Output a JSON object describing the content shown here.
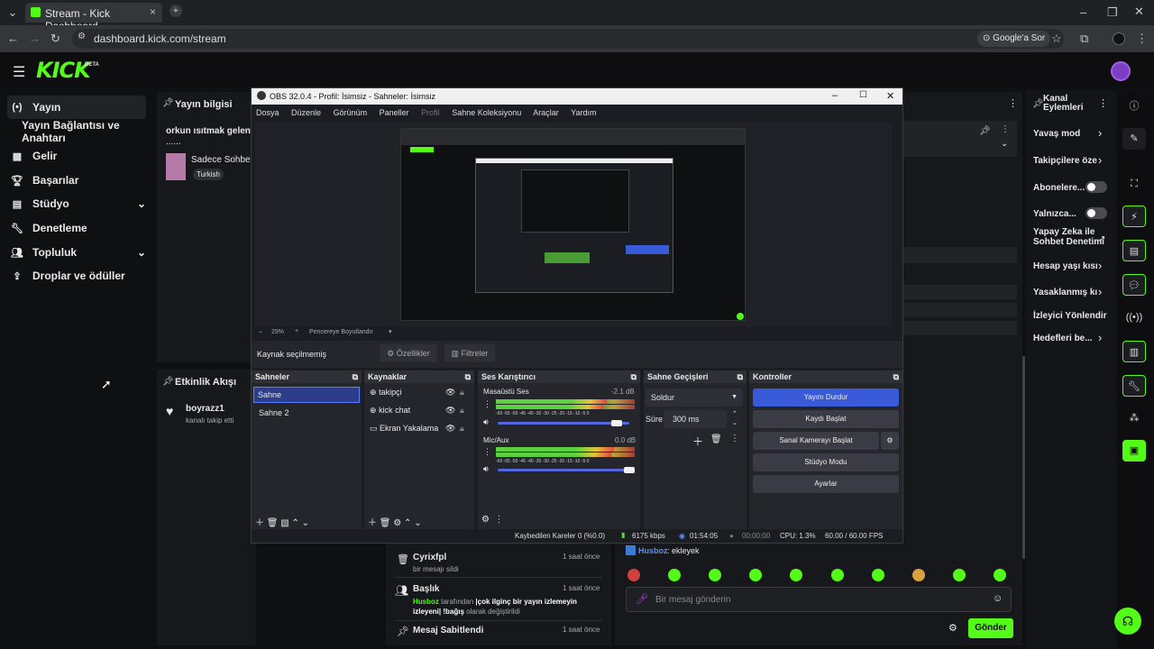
{
  "browser": {
    "tab_title": "Stream - Kick Dashboard",
    "url": "dashboard.kick.com/stream",
    "google_button": "Google'a Sor"
  },
  "kick": {
    "logo": "KICK",
    "beta": "BETA"
  },
  "nav": {
    "items": [
      {
        "label": "Yayın"
      },
      {
        "label": "Yayın Bağlantısı ve Anahtarı"
      },
      {
        "label": "Gelir"
      },
      {
        "label": "Başarılar"
      },
      {
        "label": "Stüdyo"
      },
      {
        "label": "Denetleme"
      },
      {
        "label": "Topluluk"
      },
      {
        "label": "Droplar ve ödüller"
      }
    ]
  },
  "stream_info": {
    "title": "Yayın bilgisi",
    "stream_title": "orkun ısıtmak gelene",
    "dots": "......",
    "category": "Sadece Sohbet",
    "tag": "Turkish"
  },
  "activity": {
    "title": "Etkinlik Akışı",
    "user": "boyrazz1",
    "text": "kanalı takip etti"
  },
  "mod_log": [
    {
      "title": "Cyrixfpl",
      "time": "1 saat önce",
      "text": "bir mesajı sildi"
    },
    {
      "title": "Başlık",
      "time": "1 saat önce",
      "user": "Husboz",
      "text1": "tarafından",
      "text2": "|çok ilginç bir yayın izlemeyin izleyeni| !bağış",
      "text3": "olarak değiştirildi"
    },
    {
      "title": "Mesaj Sabitlendi",
      "time": "1 saat önce"
    }
  ],
  "chat": {
    "last_user": "Husboz",
    "last_message": ": ekleyek",
    "placeholder": "Bir mesaj gönderin",
    "send": "Gönder"
  },
  "channel_actions": {
    "title": "Kanal Eylemleri",
    "items": [
      {
        "label": "Yavaş mod"
      },
      {
        "label": "Takipçilere öze"
      },
      {
        "label": "Abonelere..."
      },
      {
        "label": "Yalnızca..."
      },
      {
        "label": "Yapay Zeka ile Sohbet Denetimi"
      },
      {
        "label": "Hesap yaşı kısı"
      },
      {
        "label": "Yasaklanmış kı"
      },
      {
        "label": "İzleyici Yönlendir"
      },
      {
        "label": "Hedefleri be..."
      }
    ]
  },
  "obs": {
    "title": "OBS 32.0.4 - Profil: İsimsiz - Sahneler: İsimsiz",
    "menu": [
      "Dosya",
      "Düzenle",
      "Görünüm",
      "Paneller",
      "Profil",
      "Sahne Koleksiyonu",
      "Araçlar",
      "Yardım"
    ],
    "zoom": "29%",
    "fit": "Pencereye Boyutlandır",
    "no_source": "Kaynak seçilmemiş",
    "properties": "Özellikler",
    "filters": "Filtreler",
    "scenes_title": "Sahneler",
    "scenes": [
      "Sahne",
      "Sahne 2"
    ],
    "sources_title": "Kaynaklar",
    "sources": [
      "takipçi",
      "kick chat",
      "Ekran Yakalama"
    ],
    "mixer_title": "Ses Karıştırıcı",
    "mixer": [
      {
        "name": "Masaüstü Ses",
        "db": "-2.1 dB",
        "level": 0.8
      },
      {
        "name": "Mic/Aux",
        "db": "0.0 dB",
        "level": 0.85
      }
    ],
    "scale": "-60 -55 -50 -45 -40 -35 -30 -25 -20 -15 -10 -5 0",
    "transitions_title": "Sahne Geçişleri",
    "transition": "Soldur",
    "duration_label": "Süre",
    "duration": "300 ms",
    "controls_title": "Kontroller",
    "controls": [
      "Yayını Durdur",
      "Kaydı Başlat",
      "Sanal Kamerayı Başlat",
      "Stüdyo Modu",
      "Ayarlar"
    ],
    "status": {
      "dropped": "Kaybedilen Kareler 0 (%0.0)",
      "bitrate": "6175 kbps",
      "stream_time": "01:54:05",
      "rec_time": "00:00:00",
      "cpu": "CPU: 1.3%",
      "fps": "60.00 / 60.00 FPS"
    }
  },
  "colors": {
    "accent": "#53fc18",
    "obs_blue": "#3a5bd9"
  }
}
